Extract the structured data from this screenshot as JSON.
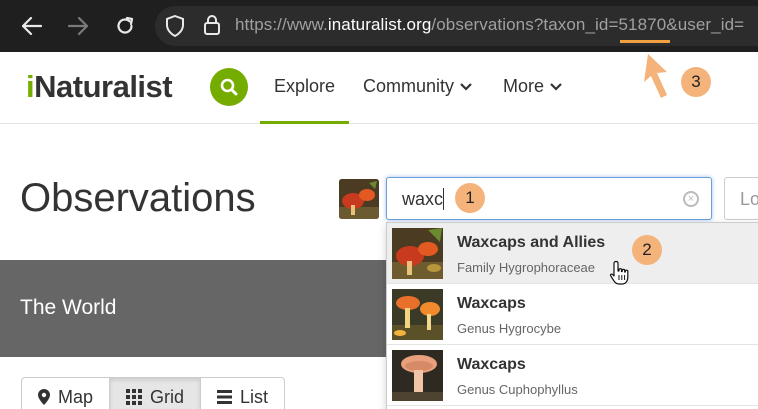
{
  "browser": {
    "url_prefix": "https://www.",
    "url_domain": "inaturalist.org",
    "url_path": "/observations?taxon_id=",
    "url_taxon_id": "51870",
    "url_suffix": "&user_id="
  },
  "site": {
    "logo_i": "i",
    "logo_rest": "Naturalist",
    "nav": {
      "explore": "Explore",
      "community": "Community",
      "more": "More"
    }
  },
  "page": {
    "title": "Observations",
    "taxon_search": {
      "value": "waxc"
    },
    "location_search": {
      "placeholder": "Lo"
    },
    "place_label": "The World",
    "views": {
      "map": "Map",
      "grid": "Grid",
      "list": "List",
      "active": "grid"
    }
  },
  "dropdown": {
    "items": [
      {
        "name": "Waxcaps and Allies",
        "rank": "Family Hygrophoraceae",
        "highlighted": true
      },
      {
        "name": "Waxcaps",
        "rank": "Genus Hygrocybe"
      },
      {
        "name": "Waxcaps",
        "rank": "Genus Cuphophyllus"
      }
    ]
  },
  "annotations": {
    "step1": "1",
    "step2": "2",
    "step3": "3",
    "color": "#f5b37c"
  },
  "colors": {
    "brand_green": "#74ac00",
    "focus_blue": "#6aa0d9",
    "band_gray": "#666666"
  }
}
